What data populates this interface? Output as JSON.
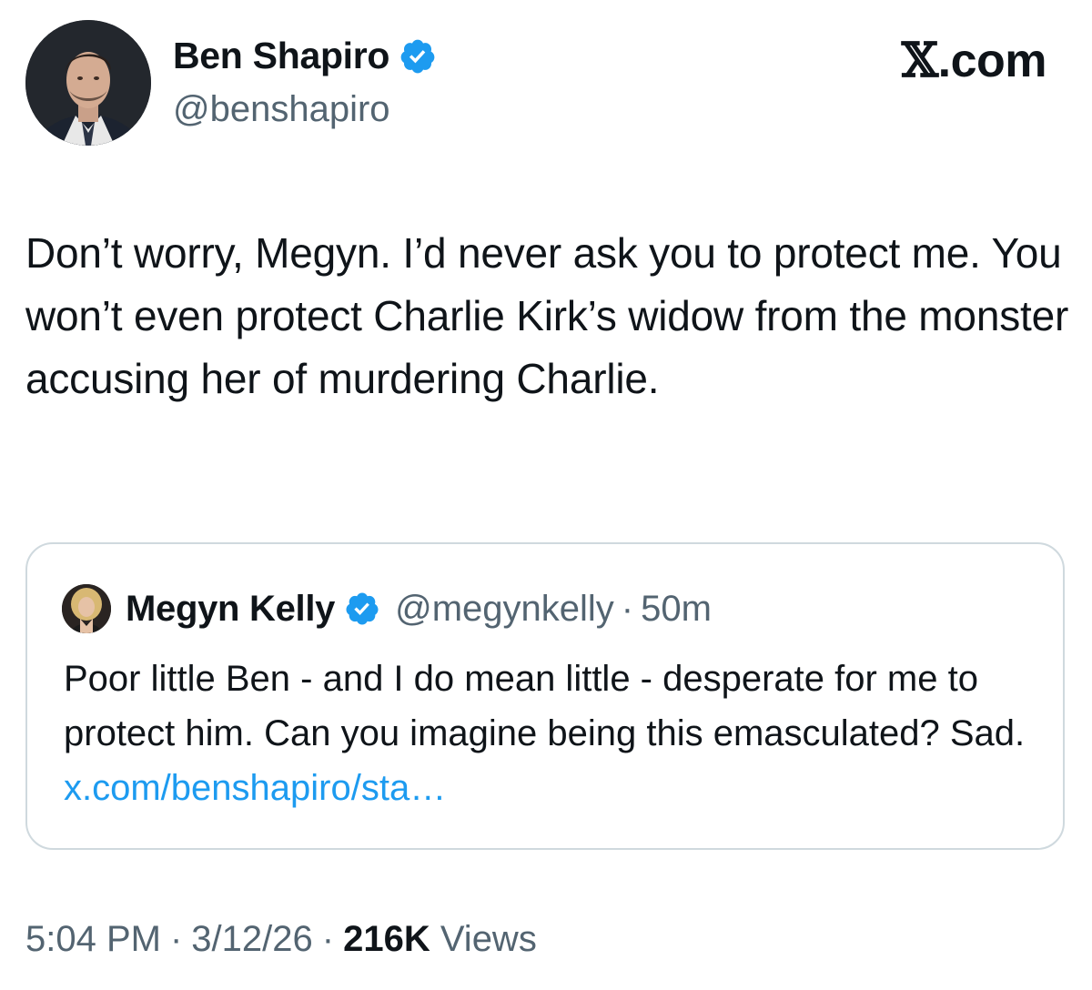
{
  "author": {
    "display_name": "Ben Shapiro",
    "handle": "@benshapiro",
    "verified": true,
    "avatar_icon": "profile-photo"
  },
  "brand": {
    "label": ".com",
    "glyph": "𝕏"
  },
  "tweet": {
    "text": "Don’t worry, Megyn. I’d never ask you to protect me. You won’t even protect Charlie Kirk’s widow from the monster accusing her of murdering Charlie."
  },
  "quoted": {
    "display_name": "Megyn Kelly",
    "handle": "@megynkelly",
    "separator": "·",
    "time": "50m",
    "text": "Poor little Ben - and I do mean little - desperate for me to protect him. Can you imagine being this emasculated? Sad.",
    "link": "x.com/benshapiro/sta…"
  },
  "meta": {
    "time": "5:04 PM",
    "separator": "·",
    "date": "3/12/26",
    "views_count": "216K",
    "views_label": "Views"
  },
  "colors": {
    "verified_blue": "#1d9bf0",
    "text_primary": "#0f1419",
    "text_secondary": "#536471",
    "border": "#cfd9de"
  }
}
